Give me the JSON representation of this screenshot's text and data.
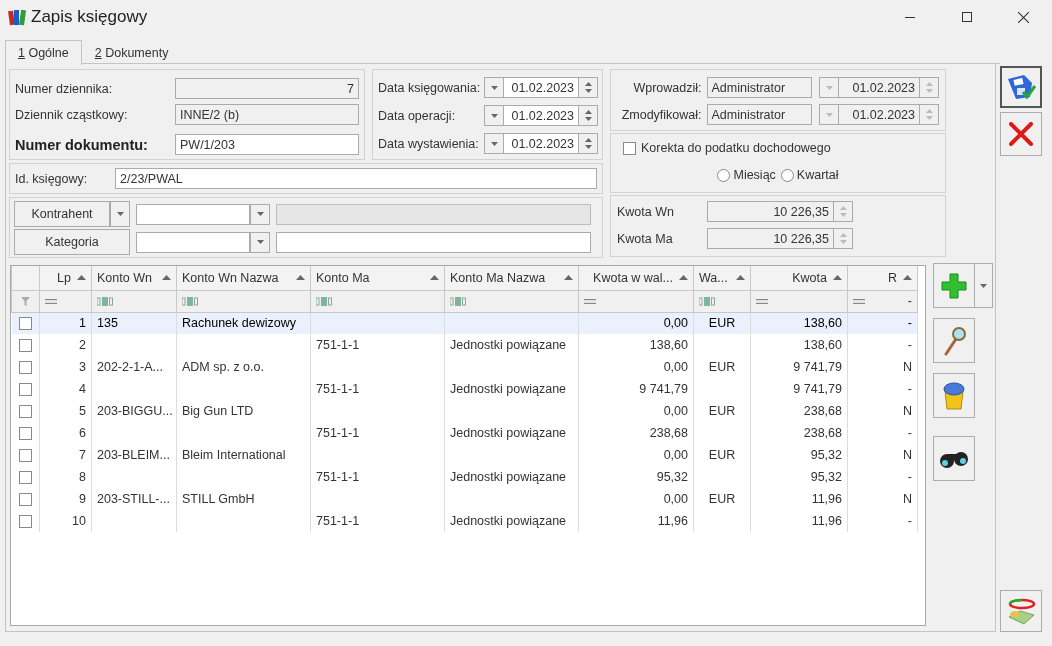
{
  "window": {
    "title": "Zapis księgowy"
  },
  "tabs": [
    {
      "label": "1 Ogólne",
      "selected": true
    },
    {
      "label": "2 Dokumenty",
      "selected": false
    }
  ],
  "journal": {
    "number_label": "Numer dziennika:",
    "number": "7",
    "sub_label": "Dziennik cząstkowy:",
    "sub": "INNE/2 (b)",
    "document_label": "Numer dokumentu:",
    "document": "PW/1/203"
  },
  "dates": [
    {
      "label": "Data księgowania:",
      "value": "01.02.2023"
    },
    {
      "label": "Data operacji:",
      "value": "01.02.2023"
    },
    {
      "label": "Data wystawienia:",
      "value": "01.02.2023"
    }
  ],
  "accounting_id": {
    "label": "Id. księgowy:",
    "value": "2/23/PWAL"
  },
  "lookups": [
    {
      "button": "Kontrahent",
      "has_menu": true,
      "details_disabled": true
    },
    {
      "button": "Kategoria",
      "has_menu": false,
      "details_disabled": false
    }
  ],
  "audit": [
    {
      "label": "Wprowadził:",
      "user": "Administrator",
      "date": "01.02.2023"
    },
    {
      "label": "Zmodyfikował:",
      "user": "Administrator",
      "date": "01.02.2023"
    }
  ],
  "income_tax_correction": {
    "label": "Korekta do podatku dochodowego",
    "checked": false,
    "periods": [
      {
        "label": "Miesiąc",
        "selected": false
      },
      {
        "label": "Kwartał",
        "selected": false
      }
    ]
  },
  "totals": [
    {
      "label": "Kwota Wn",
      "value": "10 226,35"
    },
    {
      "label": "Kwota Ma",
      "value": "10 226,35"
    }
  ],
  "table": {
    "columns": [
      {
        "label": "Lp",
        "kind": "number"
      },
      {
        "label": "Konto Wn",
        "kind": "text"
      },
      {
        "label": "Konto Wn Nazwa",
        "kind": "text"
      },
      {
        "label": "Konto Ma",
        "kind": "text"
      },
      {
        "label": "Konto Ma Nazwa",
        "kind": "text"
      },
      {
        "label": "Kwota w wal...",
        "kind": "number"
      },
      {
        "label": "Wa...",
        "kind": "code"
      },
      {
        "label": "Kwota",
        "kind": "number"
      },
      {
        "label": "R",
        "kind": "number",
        "filter_value": "-"
      }
    ],
    "rows": [
      {
        "checked": false,
        "selected": true,
        "cells": [
          "1",
          "135",
          "Rachunek dewizowy",
          null,
          null,
          "0,00",
          "EUR",
          "138,60",
          "-"
        ]
      },
      {
        "checked": false,
        "selected": false,
        "cells": [
          "2",
          null,
          null,
          "751-1-1",
          "Jednostki powiązane",
          "138,60",
          null,
          "138,60",
          "-"
        ]
      },
      {
        "checked": false,
        "selected": false,
        "cells": [
          "3",
          "202-2-1-A...",
          "ADM sp. z o.o.",
          null,
          null,
          "0,00",
          "EUR",
          "9 741,79",
          "N"
        ]
      },
      {
        "checked": false,
        "selected": false,
        "cells": [
          "4",
          null,
          null,
          "751-1-1",
          "Jednostki powiązane",
          "9 741,79",
          null,
          "9 741,79",
          "-"
        ]
      },
      {
        "checked": false,
        "selected": false,
        "cells": [
          "5",
          "203-BIGGU...",
          "Big Gun LTD",
          null,
          null,
          "0,00",
          "EUR",
          "238,68",
          "N"
        ]
      },
      {
        "checked": false,
        "selected": false,
        "cells": [
          "6",
          null,
          null,
          "751-1-1",
          "Jednostki powiązane",
          "238,68",
          null,
          "238,68",
          "-"
        ]
      },
      {
        "checked": false,
        "selected": false,
        "cells": [
          "7",
          "203-BLEIM...",
          "Bleim International",
          null,
          null,
          "0,00",
          "EUR",
          "95,32",
          "N"
        ]
      },
      {
        "checked": false,
        "selected": false,
        "cells": [
          "8",
          null,
          null,
          "751-1-1",
          "Jednostki powiązane",
          "95,32",
          null,
          "95,32",
          "-"
        ]
      },
      {
        "checked": false,
        "selected": false,
        "cells": [
          "9",
          "203-STILL-...",
          "STILL GmbH",
          null,
          null,
          "0,00",
          "EUR",
          "11,96",
          "N"
        ]
      },
      {
        "checked": false,
        "selected": false,
        "cells": [
          "10",
          null,
          null,
          "751-1-1",
          "Jednostki powiązane",
          "11,96",
          null,
          "11,96",
          "-"
        ]
      }
    ]
  }
}
